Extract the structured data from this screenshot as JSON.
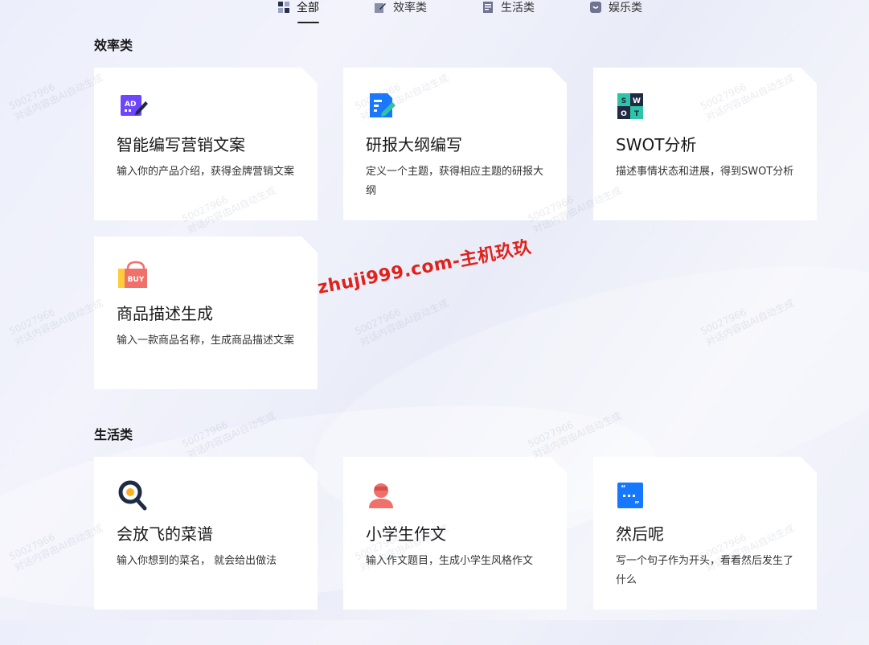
{
  "tabs": [
    {
      "label": "全部",
      "icon": "grid-icon",
      "active": true
    },
    {
      "label": "效率类",
      "icon": "edit-icon",
      "active": false
    },
    {
      "label": "生活类",
      "icon": "notes-icon",
      "active": false
    },
    {
      "label": "娱乐类",
      "icon": "smile-icon",
      "active": false
    }
  ],
  "sections": {
    "efficiency": {
      "title": "效率类",
      "cards": [
        {
          "title": "智能编写营销文案",
          "desc": "输入你的产品介绍，获得金牌营销文案",
          "icon": "ad-writing-icon"
        },
        {
          "title": "研报大纲编写",
          "desc": "定义一个主题，获得相应主题的研报大纲",
          "icon": "document-outline-icon"
        },
        {
          "title": "SWOT分析",
          "desc": "描述事情状态和进展，得到SWOT分析",
          "icon": "swot-grid-icon",
          "icon_letters": [
            "S",
            "W",
            "O",
            "T"
          ]
        },
        {
          "title": "商品描述生成",
          "desc": "输入一款商品名称，生成商品描述文案",
          "icon": "shopping-bag-icon",
          "icon_text": "BUY"
        }
      ]
    },
    "life": {
      "title": "生活类",
      "cards": [
        {
          "title": "会放飞的菜谱",
          "desc": "输入你想到的菜名， 就会给出做法",
          "icon": "search-magnifier-icon"
        },
        {
          "title": "小学生作文",
          "desc": "输入作文题目，生成小学生风格作文",
          "icon": "student-avatar-icon"
        },
        {
          "title": "然后呢",
          "desc": "写一个句子作为开头，看看然后发生了什么",
          "icon": "quote-chat-icon"
        }
      ]
    }
  },
  "watermark": {
    "line1": "50027966",
    "line2": "对话内容由AI自动生成"
  },
  "promo_text": "zhuji999.com-主机玖玖",
  "colors": {
    "accent_purple": "#6c47ff",
    "accent_blue": "#1677ff",
    "swot_teal": "#2ec4a6",
    "swot_dark": "#1f2a44",
    "promo_red": "#e0221c"
  }
}
